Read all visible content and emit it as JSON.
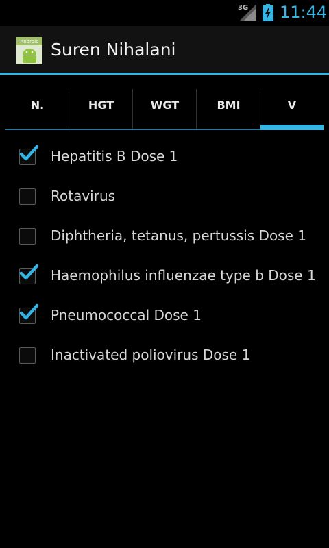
{
  "status_bar": {
    "network": "3G",
    "time": "11:44",
    "accent": "#33b5e5"
  },
  "action_bar": {
    "icon_text": "Android",
    "title": "Suren Nihalani"
  },
  "tabs": [
    {
      "label": "N.",
      "selected": false
    },
    {
      "label": "HGT",
      "selected": false
    },
    {
      "label": "WGT",
      "selected": false
    },
    {
      "label": "BMI",
      "selected": false
    },
    {
      "label": "V",
      "selected": true
    }
  ],
  "vaccines": [
    {
      "label": "Hepatitis B Dose 1",
      "checked": true
    },
    {
      "label": "Rotavirus",
      "checked": false
    },
    {
      "label": "Diphtheria, tetanus, pertussis Dose 1",
      "checked": false
    },
    {
      "label": "Haemophilus influenzae type b Dose 1",
      "checked": true
    },
    {
      "label": "Pneumococcal Dose 1",
      "checked": true
    },
    {
      "label": "Inactivated poliovirus Dose 1",
      "checked": false
    }
  ]
}
